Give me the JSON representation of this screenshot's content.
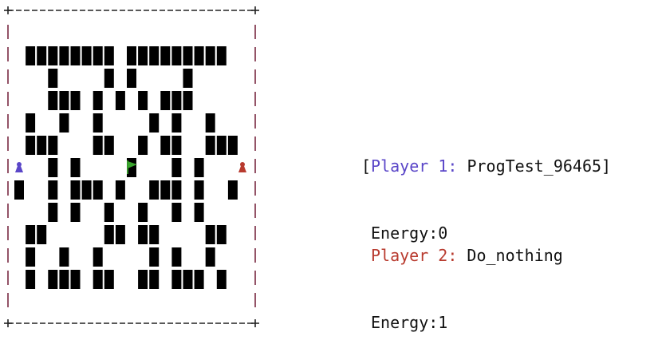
{
  "board": {
    "border_color": "#222222",
    "side_color": "#7a2a42",
    "wall_color": "#000000",
    "rows": [
      "",
      "",
      "########  #########",
      "   #    #  #    #  ",
      "   ###  # # # ###  ",
      " #  #  #    # #  # ",
      " ###   ##  # ##  ###",
      "   #  #  F  #  #   ",
      "#  #  ###  #  ###  #",
      "   #  #  #  # #  # ",
      " ##     ## ##    ##",
      " #  #  #    #  #  #",
      " #  ###  ##  ## ###  #"
    ],
    "wall_rows": [
      [
        [
          1,
          8
        ],
        [
          10,
          18
        ]
      ],
      [
        [
          3,
          3
        ],
        [
          8,
          8
        ],
        [
          10,
          10
        ],
        [
          15,
          15
        ]
      ],
      [
        [
          3,
          5
        ],
        [
          7,
          7
        ],
        [
          9,
          9
        ],
        [
          11,
          11
        ],
        [
          13,
          15
        ]
      ],
      [
        [
          1,
          1
        ],
        [
          4,
          4
        ],
        [
          7,
          7
        ],
        [
          12,
          12
        ],
        [
          14,
          14
        ],
        [
          17,
          17
        ]
      ],
      [
        [
          1,
          3
        ],
        [
          7,
          8
        ],
        [
          11,
          11
        ],
        [
          13,
          14
        ],
        [
          17,
          19
        ]
      ],
      [
        [
          3,
          3
        ],
        [
          5,
          5
        ],
        [
          10,
          10
        ],
        [
          14,
          14
        ],
        [
          16,
          16
        ]
      ],
      [
        [
          0,
          0
        ],
        [
          3,
          3
        ],
        [
          5,
          7
        ],
        [
          9,
          9
        ],
        [
          12,
          14
        ],
        [
          16,
          16
        ],
        [
          19,
          19
        ]
      ],
      [
        [
          3,
          3
        ],
        [
          5,
          5
        ],
        [
          8,
          8
        ],
        [
          11,
          11
        ],
        [
          14,
          14
        ],
        [
          16,
          16
        ]
      ],
      [
        [
          1,
          2
        ],
        [
          8,
          9
        ],
        [
          11,
          12
        ],
        [
          17,
          18
        ]
      ],
      [
        [
          1,
          1
        ],
        [
          4,
          4
        ],
        [
          7,
          7
        ],
        [
          12,
          12
        ],
        [
          14,
          14
        ],
        [
          17,
          17
        ]
      ],
      [
        [
          1,
          1
        ],
        [
          3,
          5
        ],
        [
          7,
          8
        ],
        [
          11,
          12
        ],
        [
          14,
          16
        ],
        [
          18,
          18
        ]
      ]
    ],
    "player1_color": "#5a46c8",
    "player2_color": "#b83a2e",
    "flag_color": "#3aa52e",
    "player1_icon": "pawn-icon",
    "player2_icon": "pawn-icon",
    "flag_icon": "flag-icon"
  },
  "player1": {
    "label": "Player 1:",
    "name": "ProgTest_96465",
    "open_bracket": "[",
    "close_bracket": "]",
    "energy_label": "Energy:",
    "energy_value": "0",
    "color": "#5a46c8"
  },
  "player2": {
    "label": "Player 2:",
    "name": "Do_nothing",
    "energy_label": "Energy:",
    "energy_value": "1",
    "color": "#b83a2e"
  }
}
